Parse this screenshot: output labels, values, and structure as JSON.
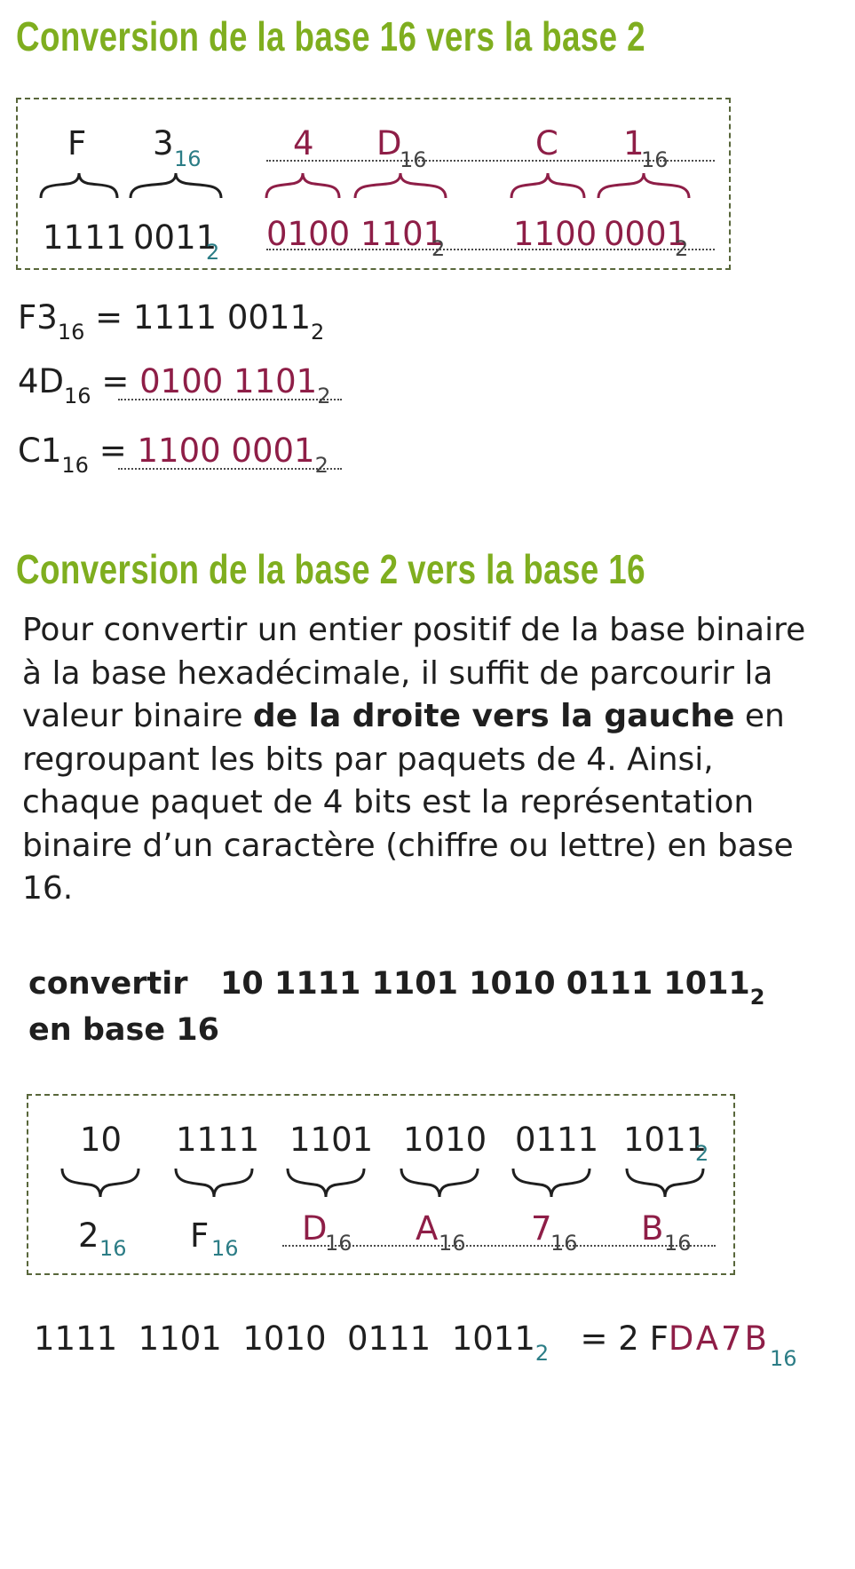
{
  "section1": {
    "title": "Conversion de la base 16 vers la base 2",
    "box": {
      "groups": [
        {
          "hex": "F",
          "bin": "1111"
        },
        {
          "hex": "3",
          "hex_sub": "16",
          "bin": "0011",
          "bin_sub": "2"
        },
        {
          "hex": "4",
          "bin": "0100"
        },
        {
          "hex": "D",
          "hex_sub": "16",
          "bin": "1101",
          "bin_sub": "2"
        },
        {
          "hex": "C",
          "bin": "1100"
        },
        {
          "hex": "1",
          "hex_sub": "16",
          "bin": "0001",
          "bin_sub": "2"
        }
      ]
    },
    "equations": [
      {
        "lhs": "F3",
        "lhs_sub": "16",
        "eq": "=",
        "rhs": "1111 0011",
        "rhs_sub": "2"
      },
      {
        "lhs": "4D",
        "lhs_sub": "16",
        "eq": "=",
        "rhs": "0100 1101",
        "rhs_sub": "2"
      },
      {
        "lhs": "C1",
        "lhs_sub": "16",
        "eq": "=",
        "rhs": "1100 0001",
        "rhs_sub": "2"
      }
    ]
  },
  "section2": {
    "title": "Conversion de la base 2 vers la base 16",
    "paragraph": {
      "part1": "Pour convertir un entier positif de la base binaire à la base hexadécimale, il suffit de parcourir la valeur binaire ",
      "bold": "de la droite vers la gauche",
      "part2": " en regroupant les bits par paquets de 4. Ainsi, chaque paquet de 4 bits est la représentation binaire d’un caractère (chiffre ou lettre) en base 16."
    },
    "task": {
      "verb": "convertir",
      "value": "10 1111 1101 1010 0111 1011",
      "value_sub": "2",
      "line2": "en base 16"
    },
    "box": {
      "groups": [
        {
          "bin": "10",
          "hex": "2",
          "hex_sub": "16"
        },
        {
          "bin": "1111",
          "hex": "F",
          "hex_sub": "16"
        },
        {
          "bin": "1101",
          "hex": "D",
          "hex_sub": "16"
        },
        {
          "bin": "1010",
          "hex": "A",
          "hex_sub": "16"
        },
        {
          "bin": "0111",
          "hex": "7",
          "hex_sub": "16"
        },
        {
          "bin": "1011",
          "bin_sub": "2",
          "hex": "B",
          "hex_sub": "16"
        }
      ]
    },
    "result": {
      "bin": "1111  1101  1010  0111  1011",
      "bin_sub": "2",
      "eq": "=",
      "hex_given": "2 F",
      "hex_answer": "DA7B",
      "hex_sub": "16"
    }
  },
  "colors": {
    "title": "#7fae1f",
    "answer": "#8e1e47",
    "subscript_teal": "#2c7d86",
    "box_border": "#58663a"
  }
}
